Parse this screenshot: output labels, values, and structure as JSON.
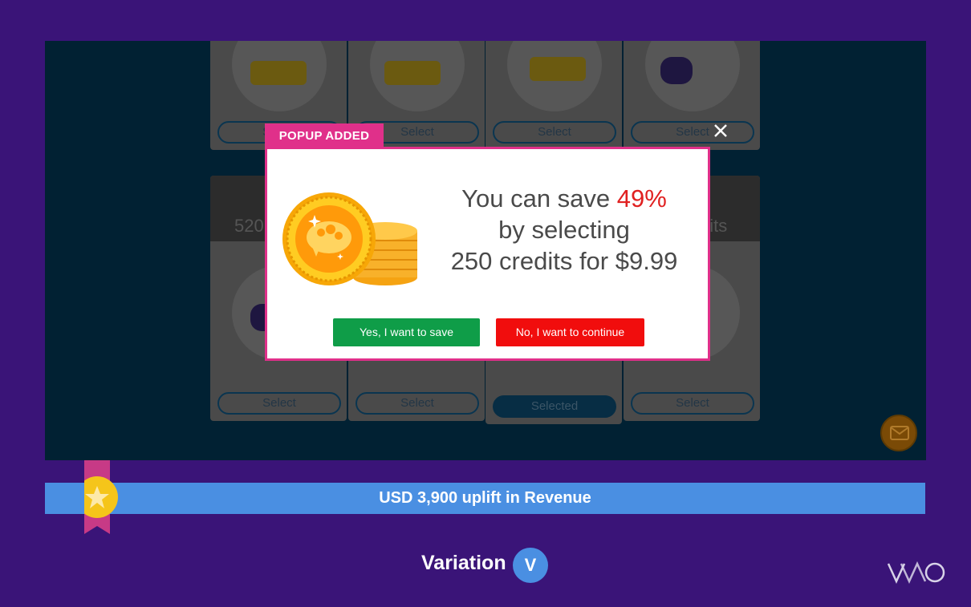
{
  "cards": {
    "select_label": "Select",
    "selected_label": "Selected",
    "partial_left": "520",
    "partial_right": "dits"
  },
  "popup": {
    "tag": "POPUP ADDED",
    "line1_prefix": "You can save ",
    "line1_percent": "49%",
    "line2": "by selecting",
    "line3": "250 credits for $9.99",
    "yes_button": "Yes, I want to save",
    "no_button": "No, I want to continue",
    "close_icon": "close-icon",
    "image_icon": "gold-coin-stack-icon"
  },
  "banner": {
    "text": "USD 3,900 uplift in Revenue",
    "badge_icon": "star-ribbon-icon"
  },
  "footer": {
    "variation_label": "Variation",
    "variation_badge": "V",
    "logo": "VWO"
  },
  "colors": {
    "background": "#3a1478",
    "popup_accent": "#e0308a",
    "yes_green": "#0f9d48",
    "no_red": "#f10d0d",
    "banner_blue": "#4a8fe2",
    "highlight_red": "#e02020"
  }
}
